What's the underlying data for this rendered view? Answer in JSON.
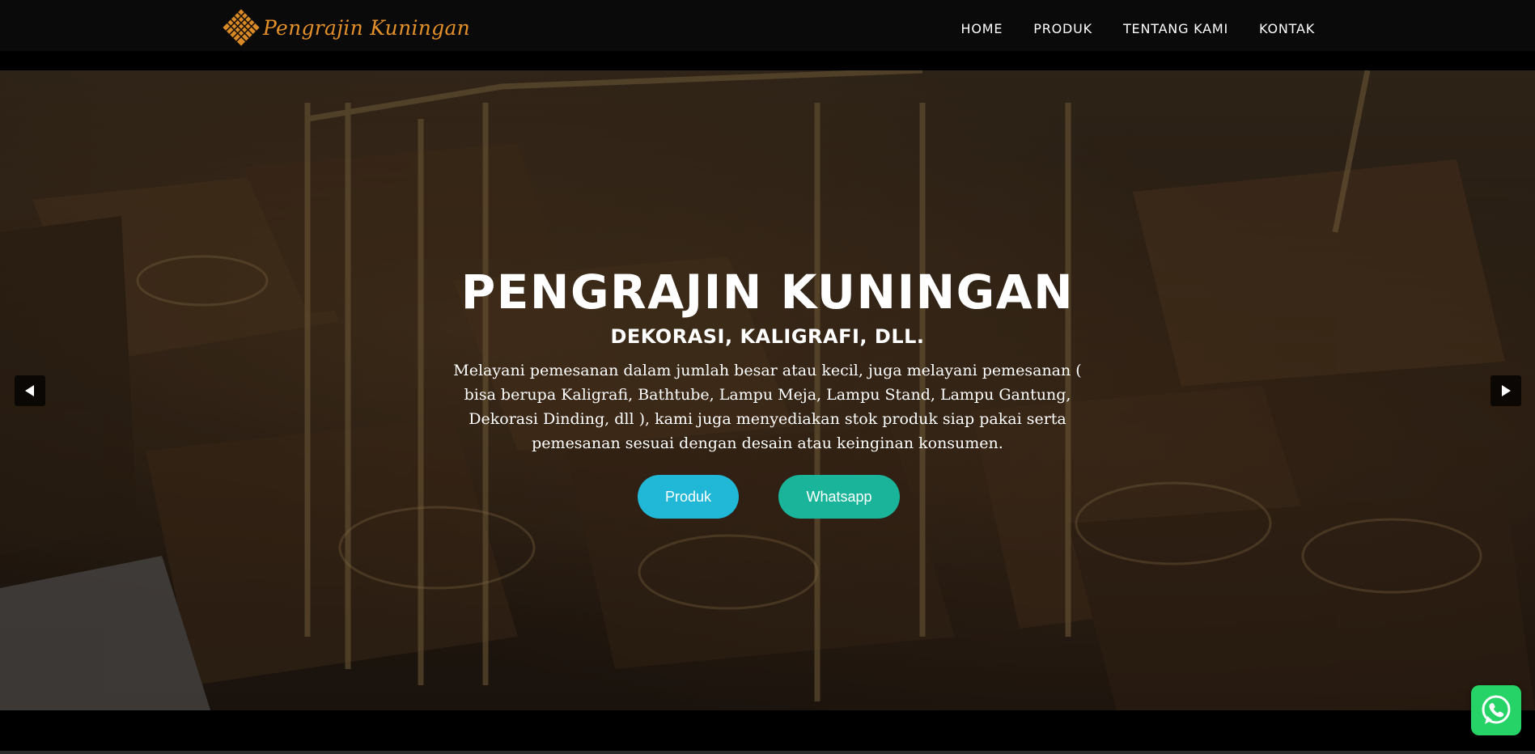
{
  "brand": {
    "name": "Pengrajin Kuningan",
    "logo_icon": "woven-diamond-logo",
    "color": "#e4902a"
  },
  "nav": {
    "items": [
      {
        "label": "HOME"
      },
      {
        "label": "PRODUK"
      },
      {
        "label": "TENTANG KAMI"
      },
      {
        "label": "KONTAK"
      }
    ]
  },
  "hero": {
    "title": "PENGRAJIN KUNINGAN",
    "subtitle": "DEKORASI, KALIGRAFI, DLL.",
    "description": "Melayani pemesanan dalam jumlah besar atau kecil, juga melayani pemesanan ( bisa berupa Kaligrafi, Bathtube, Lampu Meja, Lampu Stand, Lampu Gantung, Dekorasi Dinding, dll ), kami juga menyediakan stok produk siap pakai serta pemesanan sesuai dengan desain atau keinginan konsumen.",
    "buttons": {
      "produk": "Produk",
      "whatsapp": "Whatsapp"
    },
    "background_image": "brass-carved-boxes-photo"
  },
  "carousel": {
    "prev_icon": "caret-left-icon",
    "next_icon": "caret-right-icon"
  },
  "floating": {
    "whatsapp_icon": "whatsapp-icon"
  },
  "colors": {
    "navbar_bg": "#0a0a0a",
    "button_produk": "#21b7d6",
    "button_whatsapp": "#1ab49a",
    "whatsapp_float": "#25d366"
  }
}
